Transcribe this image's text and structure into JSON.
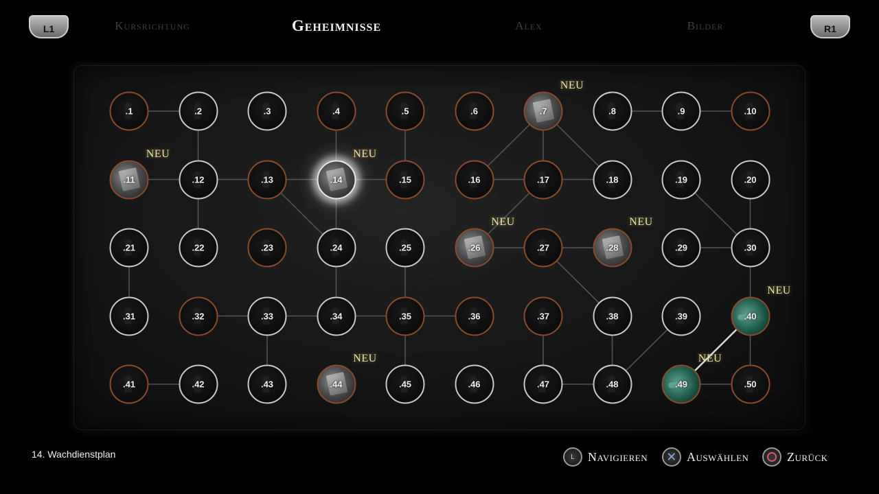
{
  "shoulder": {
    "left": "L1",
    "right": "R1"
  },
  "tabs": [
    {
      "label": "Kursrichtung",
      "active": false
    },
    {
      "label": "Geheimnisse",
      "active": true
    },
    {
      "label": "Alex",
      "active": false
    },
    {
      "label": "Bilder",
      "active": false
    }
  ],
  "new_badge": "NEU",
  "selected_item": "14. Wachdienstplan",
  "hints": [
    {
      "icon": "left-stick-icon",
      "glyph": "L",
      "label": "Navigieren"
    },
    {
      "icon": "cross-button-icon",
      "glyph": "✕",
      "label": "Auswählen"
    },
    {
      "icon": "circle-button-icon",
      "glyph": "",
      "label": "Zurück"
    }
  ],
  "nodes": [
    {
      "id": 1,
      "label": ".1",
      "ring": "rust"
    },
    {
      "id": 2,
      "label": ".2",
      "ring": "white"
    },
    {
      "id": 3,
      "label": ".3",
      "ring": "white"
    },
    {
      "id": 4,
      "label": ".4",
      "ring": "rust"
    },
    {
      "id": 5,
      "label": ".5",
      "ring": "rust"
    },
    {
      "id": 6,
      "label": ".6",
      "ring": "rust"
    },
    {
      "id": 7,
      "label": ".7",
      "ring": "rust",
      "photo": "doc",
      "is_new": true
    },
    {
      "id": 8,
      "label": ".8",
      "ring": "white"
    },
    {
      "id": 9,
      "label": ".9",
      "ring": "white"
    },
    {
      "id": 10,
      "label": ".10",
      "ring": "rust"
    },
    {
      "id": 11,
      "label": ".11",
      "ring": "rust",
      "photo": "doc",
      "is_new": true
    },
    {
      "id": 12,
      "label": ".12",
      "ring": "white"
    },
    {
      "id": 13,
      "label": ".13",
      "ring": "rust"
    },
    {
      "id": 14,
      "label": ".14",
      "ring": "rust",
      "photo": "doc",
      "is_new": true,
      "selected": true
    },
    {
      "id": 15,
      "label": ".15",
      "ring": "rust"
    },
    {
      "id": 16,
      "label": ".16",
      "ring": "rust"
    },
    {
      "id": 17,
      "label": ".17",
      "ring": "rust"
    },
    {
      "id": 18,
      "label": ".18",
      "ring": "white"
    },
    {
      "id": 19,
      "label": ".19",
      "ring": "white"
    },
    {
      "id": 20,
      "label": ".20",
      "ring": "white"
    },
    {
      "id": 21,
      "label": ".21",
      "ring": "white"
    },
    {
      "id": 22,
      "label": ".22",
      "ring": "white"
    },
    {
      "id": 23,
      "label": ".23",
      "ring": "rust"
    },
    {
      "id": 24,
      "label": ".24",
      "ring": "white"
    },
    {
      "id": 25,
      "label": ".25",
      "ring": "white"
    },
    {
      "id": 26,
      "label": ".26",
      "ring": "rust",
      "photo": "doc",
      "is_new": true
    },
    {
      "id": 27,
      "label": ".27",
      "ring": "rust"
    },
    {
      "id": 28,
      "label": ".28",
      "ring": "rust",
      "photo": "doc",
      "is_new": true
    },
    {
      "id": 29,
      "label": ".29",
      "ring": "white"
    },
    {
      "id": 30,
      "label": ".30",
      "ring": "white"
    },
    {
      "id": 31,
      "label": ".31",
      "ring": "white"
    },
    {
      "id": 32,
      "label": ".32",
      "ring": "rust"
    },
    {
      "id": 33,
      "label": ".33",
      "ring": "white"
    },
    {
      "id": 34,
      "label": ".34",
      "ring": "white"
    },
    {
      "id": 35,
      "label": ".35",
      "ring": "rust"
    },
    {
      "id": 36,
      "label": ".36",
      "ring": "rust"
    },
    {
      "id": 37,
      "label": ".37",
      "ring": "rust"
    },
    {
      "id": 38,
      "label": ".38",
      "ring": "white"
    },
    {
      "id": 39,
      "label": ".39",
      "ring": "white"
    },
    {
      "id": 40,
      "label": ".40",
      "ring": "rust",
      "photo": "green",
      "is_new": true
    },
    {
      "id": 41,
      "label": ".41",
      "ring": "rust"
    },
    {
      "id": 42,
      "label": ".42",
      "ring": "white"
    },
    {
      "id": 43,
      "label": ".43",
      "ring": "white"
    },
    {
      "id": 44,
      "label": ".44",
      "ring": "rust",
      "photo": "doc",
      "is_new": true
    },
    {
      "id": 45,
      "label": ".45",
      "ring": "white"
    },
    {
      "id": 46,
      "label": ".46",
      "ring": "white"
    },
    {
      "id": 47,
      "label": ".47",
      "ring": "white"
    },
    {
      "id": 48,
      "label": ".48",
      "ring": "white"
    },
    {
      "id": 49,
      "label": ".49",
      "ring": "rust",
      "photo": "green",
      "is_new": true
    },
    {
      "id": 50,
      "label": ".50",
      "ring": "rust"
    }
  ],
  "links": [
    [
      1,
      2
    ],
    [
      2,
      12
    ],
    [
      9,
      10
    ],
    [
      8,
      9
    ],
    [
      4,
      14
    ],
    [
      5,
      15
    ],
    [
      7,
      16
    ],
    [
      7,
      17
    ],
    [
      7,
      18
    ],
    [
      11,
      12
    ],
    [
      12,
      13
    ],
    [
      13,
      14
    ],
    [
      14,
      15
    ],
    [
      12,
      22
    ],
    [
      14,
      24
    ],
    [
      13,
      24
    ],
    [
      16,
      17
    ],
    [
      17,
      18
    ],
    [
      17,
      26
    ],
    [
      20,
      30
    ],
    [
      19,
      30
    ],
    [
      26,
      27
    ],
    [
      27,
      28
    ],
    [
      27,
      38
    ],
    [
      29,
      30
    ],
    [
      30,
      40
    ],
    [
      21,
      31
    ],
    [
      24,
      34
    ],
    [
      25,
      35
    ],
    [
      32,
      33
    ],
    [
      33,
      34
    ],
    [
      34,
      35
    ],
    [
      35,
      36
    ],
    [
      33,
      43
    ],
    [
      35,
      45
    ],
    [
      37,
      47
    ],
    [
      38,
      48
    ],
    [
      39,
      48
    ],
    [
      40,
      49
    ],
    [
      40,
      50
    ],
    [
      41,
      42
    ],
    [
      47,
      48
    ],
    [
      49,
      50
    ]
  ]
}
